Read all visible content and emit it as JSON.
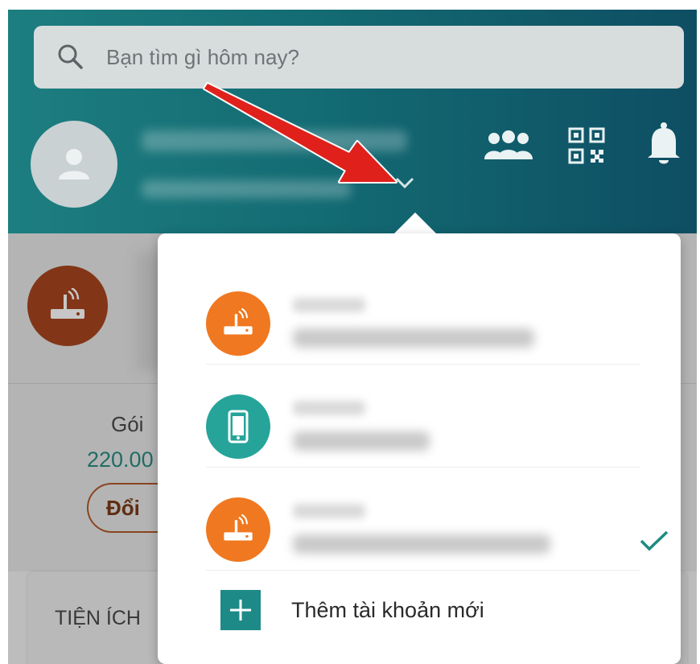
{
  "search": {
    "placeholder": "Bạn tìm gì hôm nay?"
  },
  "package": {
    "label": "Gói",
    "price": "220.00",
    "change_button": "Đổi"
  },
  "utilities": {
    "label": "TIỆN ÍCH"
  },
  "account_menu": {
    "accounts": [
      {
        "type": "router-icon",
        "color": "#f07820",
        "selected": false
      },
      {
        "type": "phone-icon",
        "color": "#26a49a",
        "selected": false
      },
      {
        "type": "router-icon",
        "color": "#f07820",
        "selected": true
      }
    ],
    "add_account_label": "Thêm tài khoản mới"
  },
  "colors": {
    "header_teal": "#1d7e80",
    "accent_teal": "#1e8a88",
    "orange": "#f07820",
    "annotation_red": "#e0201b"
  }
}
